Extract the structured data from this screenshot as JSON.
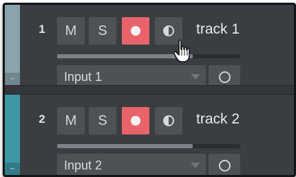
{
  "colors": {
    "track1_strip": "#8aa3ad",
    "track2_strip": "#3f97a6",
    "record_armed": "#e9646a",
    "button_bg": "#4d5257"
  },
  "tracks": [
    {
      "number": "1",
      "name": "track 1",
      "mute_label": "M",
      "solo_label": "S",
      "record_armed": true,
      "monitor_icon": "half-circle-monitor-icon",
      "volume_level": 0.74,
      "input": "Input 1",
      "strip_icon": "~"
    },
    {
      "number": "2",
      "name": "track 2",
      "mute_label": "M",
      "solo_label": "S",
      "record_armed": true,
      "monitor_icon": "half-circle-monitor-icon",
      "volume_level": 0.74,
      "input": "Input 2",
      "strip_icon": "~"
    }
  ],
  "cursor": "hand-pointer-icon"
}
